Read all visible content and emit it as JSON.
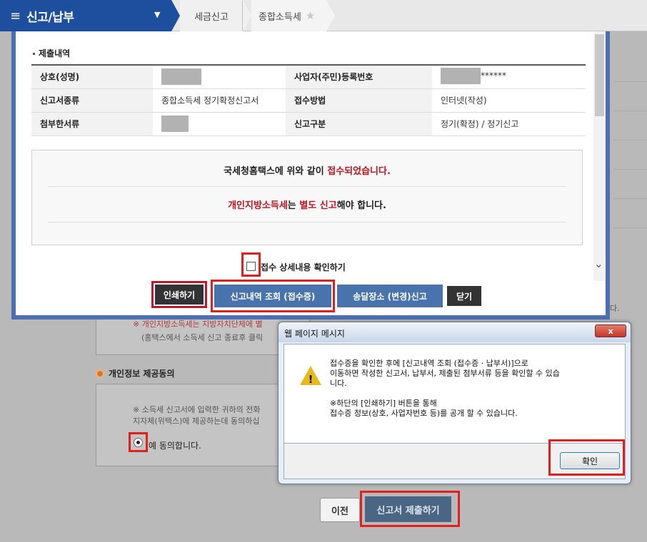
{
  "nav": {
    "menu_icon": "hamburger-icon",
    "main_title": "신고/납부",
    "dropdown_icon": "chevron-down-icon",
    "crumb1": "세금신고",
    "crumb2": "종합소득세",
    "star_icon": "star-icon"
  },
  "background": {
    "red_text": "※ 개인지방소득세는 지방자치단체에 별",
    "gray_text": "(홈택스에서 소득세 신고 종료후 클릭",
    "section_title": "개인정보 제공동의",
    "consent_line1": "※ 소득세 신고서에 입력한 귀하의 전화",
    "consent_line2": "지자체(위택스)에 제공하는데 동의하십",
    "radio_label": "예 동의합니다.",
    "prev_button": "이전",
    "submit_button": "신고서 제출하기",
    "right_fragment": "다."
  },
  "modal": {
    "section_title": "제출내역",
    "rows": [
      {
        "label1": "상호(성명)",
        "value1": "",
        "label2": "사업자(주민)등록번호",
        "value2": "******"
      },
      {
        "label1": "신고서종류",
        "value1": "종합소득세 정기확정신고서",
        "label2": "접수방법",
        "value2": "인터넷(작성)"
      },
      {
        "label1": "첨부한서류",
        "value1": "",
        "label2": "신고구분",
        "value2": "정기(확정) / 정기신고"
      }
    ],
    "notice1_pre": "국세청홈택스에 위와 같이 ",
    "notice1_red": "접수되었습니다.",
    "notice2_red1": "개인지방소득세",
    "notice2_mid": "는 ",
    "notice2_red2": "별도 신고",
    "notice2_post": "해야 합니다.",
    "checkbox_label": "접수 상세내용 확인하기",
    "btn_print": "인쇄하기",
    "btn_view": "신고내역 조회 (접수증)",
    "btn_change": "송달장소 (변경)신고",
    "btn_close": "닫기",
    "scroll_down_icon": "chevron-down-icon"
  },
  "dialog": {
    "title": "웹 페이지 메시지",
    "close_label": "x",
    "warning_icon": "warning-icon",
    "line1": "접수증을 확인한 후에 [신고내역 조회 (접수증 · 납부서)]으로",
    "line2": "이동하면 작성한 신고서, 납부서, 제출된 첨부서류 등을 확인할 수 있습",
    "line3": "니다.",
    "line4": "※하단의 [인쇄하기] 버튼을 통해",
    "line5": "접수증 정보(상호, 사업자번호 등)를 공개 할 수 있습니다.",
    "ok_button": "확인"
  },
  "colors": {
    "nav_blue": "#1e4f9e",
    "button_blue": "#4873ad",
    "highlight_red": "#e0201c",
    "notice_red": "#c1121f"
  }
}
